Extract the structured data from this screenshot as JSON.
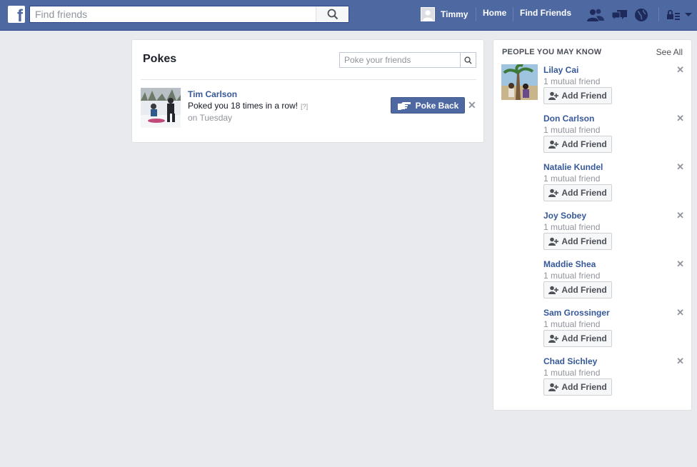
{
  "topbar": {
    "logo": "f",
    "search_placeholder": "Find friends",
    "user_name": "Timmy",
    "home": "Home",
    "find_friends": "Find Friends",
    "jewels": [
      "friend-requests-icon",
      "messages-icon",
      "notifications-globe-icon",
      "privacy-lock-icon",
      "account-menu-chevron-icon"
    ],
    "colors": {
      "bar": "#4e69a2",
      "link": "#365899"
    }
  },
  "pokes": {
    "title": "Pokes",
    "search_placeholder": "Poke your friends",
    "items": [
      {
        "name": "Tim Carlson",
        "message": "Poked you 18 times in a row!",
        "help": "[?]",
        "time": "on Tuesday",
        "button": "Poke Back"
      }
    ]
  },
  "pymk": {
    "title": "PEOPLE YOU MAY KNOW",
    "see_all": "See All",
    "people": [
      {
        "name": "Lilay Cai",
        "mutual": "1 mutual friend",
        "button": "Add Friend"
      },
      {
        "name": "Don Carlson",
        "mutual": "1 mutual friend",
        "button": "Add Friend"
      },
      {
        "name": "Natalie Kundel",
        "mutual": "1 mutual friend",
        "button": "Add Friend"
      },
      {
        "name": "Joy Sobey",
        "mutual": "1 mutual friend",
        "button": "Add Friend"
      },
      {
        "name": "Maddie Shea",
        "mutual": "1 mutual friend",
        "button": "Add Friend"
      },
      {
        "name": "Sam Grossinger",
        "mutual": "1 mutual friend",
        "button": "Add Friend"
      },
      {
        "name": "Chad Sichley",
        "mutual": "1 mutual friend",
        "button": "Add Friend"
      }
    ]
  }
}
